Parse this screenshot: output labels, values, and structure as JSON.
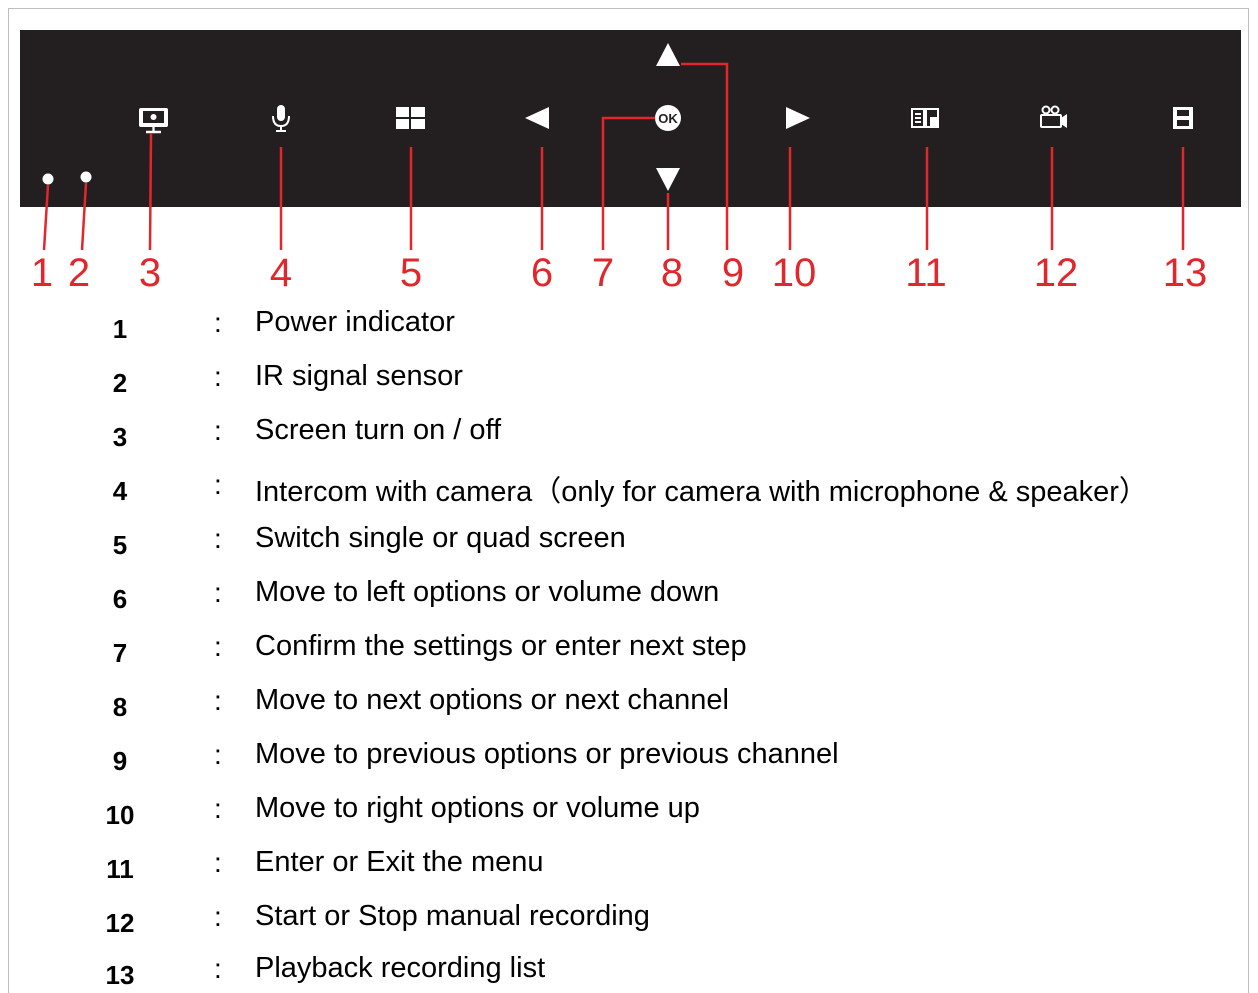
{
  "colors": {
    "panel": "#231f20",
    "callout": "#e3262b",
    "icon": "#ffffff",
    "text": "#000000"
  },
  "panel": {
    "buttons": [
      {
        "id": 1,
        "icon": "led-dot-icon"
      },
      {
        "id": 2,
        "icon": "led-dot-icon"
      },
      {
        "id": 3,
        "icon": "monitor-icon"
      },
      {
        "id": 4,
        "icon": "microphone-icon"
      },
      {
        "id": 5,
        "icon": "quad-screen-icon"
      },
      {
        "id": 6,
        "icon": "arrow-left-icon"
      },
      {
        "id": 7,
        "icon": "ok-button-icon",
        "label": "OK"
      },
      {
        "id": 8,
        "icon": "arrow-down-icon"
      },
      {
        "id": 9,
        "icon": "arrow-up-icon"
      },
      {
        "id": 10,
        "icon": "arrow-right-icon"
      },
      {
        "id": 11,
        "icon": "menu-book-icon"
      },
      {
        "id": 12,
        "icon": "video-camera-icon"
      },
      {
        "id": 13,
        "icon": "film-strip-icon"
      }
    ]
  },
  "callouts": [
    "1",
    "2",
    "3",
    "4",
    "5",
    "6",
    "7",
    "8",
    "9",
    "10",
    "11",
    "12",
    "13"
  ],
  "legend": [
    {
      "num": "1",
      "colon": ":",
      "desc": "Power indicator"
    },
    {
      "num": "2",
      "colon": ":",
      "desc": "IR signal sensor"
    },
    {
      "num": "3",
      "colon": ":",
      "desc": "Screen turn on / off"
    },
    {
      "num": "4",
      "colon": ":",
      "desc": "Intercom with camera（only for camera with microphone & speaker）"
    },
    {
      "num": "5",
      "colon": ":",
      "desc": "Switch single or quad screen"
    },
    {
      "num": "6",
      "colon": ":",
      "desc": "Move to left options or volume down"
    },
    {
      "num": "7",
      "colon": ":",
      "desc": "Confirm the settings or enter next step"
    },
    {
      "num": "8",
      "colon": ":",
      "desc": "Move to next options or next channel"
    },
    {
      "num": "9",
      "colon": ":",
      "desc": "Move to previous options or previous channel"
    },
    {
      "num": "10",
      "colon": ":",
      "desc": "Move to right options or volume up"
    },
    {
      "num": "11",
      "colon": ":",
      "desc": "Enter or Exit the menu"
    },
    {
      "num": "12",
      "colon": ":",
      "desc": "Start or Stop manual recording"
    },
    {
      "num": "13",
      "colon": ":",
      "desc": "Playback recording list"
    }
  ]
}
